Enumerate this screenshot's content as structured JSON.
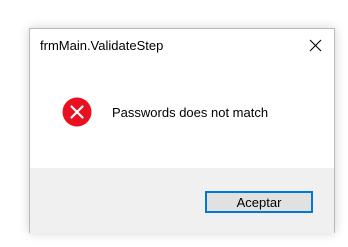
{
  "dialog": {
    "title": "frmMain.ValidateStep",
    "close_icon": "close-icon",
    "message_icon": "error-icon",
    "message": "Passwords does not match",
    "ok_button_label": "Aceptar"
  },
  "colors": {
    "error_red": "#e81123",
    "accent_blue": "#0078d7",
    "footer_bg": "#f0f0f0",
    "button_bg": "#e1e1e1"
  }
}
